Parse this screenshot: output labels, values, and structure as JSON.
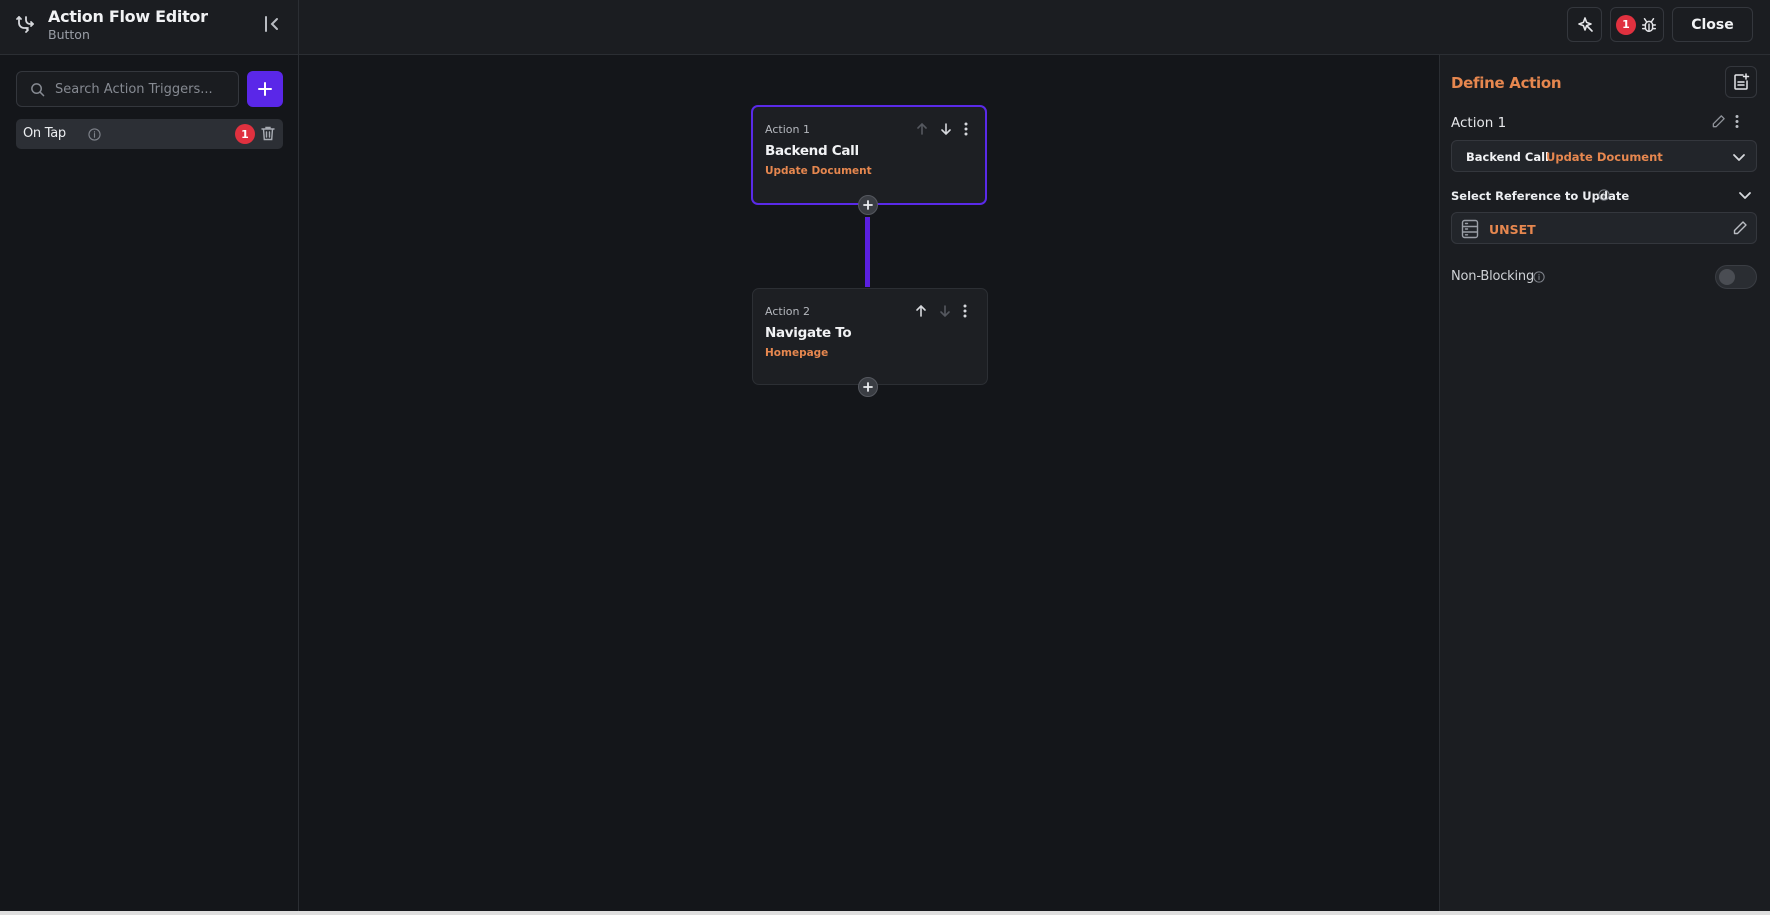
{
  "header": {
    "title": "Action Flow Editor",
    "subtitle": "Button",
    "debug_badge": "1",
    "close_label": "Close"
  },
  "sidebar": {
    "search_placeholder": "Search Action Triggers...",
    "triggers": [
      {
        "label": "On Tap",
        "badge": "1"
      }
    ]
  },
  "canvas": {
    "actions": [
      {
        "label": "Action 1",
        "title": "Backend Call",
        "subtitle": "Update Document"
      },
      {
        "label": "Action 2",
        "title": "Navigate To",
        "subtitle": "Homepage"
      }
    ]
  },
  "panel": {
    "title": "Define Action",
    "action_name": "Action 1",
    "action_type": "Backend Call",
    "action_subtype": "Update Document",
    "reference_label": "Select Reference to Update",
    "reference_value": "UNSET",
    "non_blocking_label": "Non-Blocking",
    "non_blocking_enabled": false
  },
  "colors": {
    "accent": "#5a27e8",
    "orange": "#e6874f",
    "badge_red": "#e0313f",
    "background": "#14161a"
  }
}
